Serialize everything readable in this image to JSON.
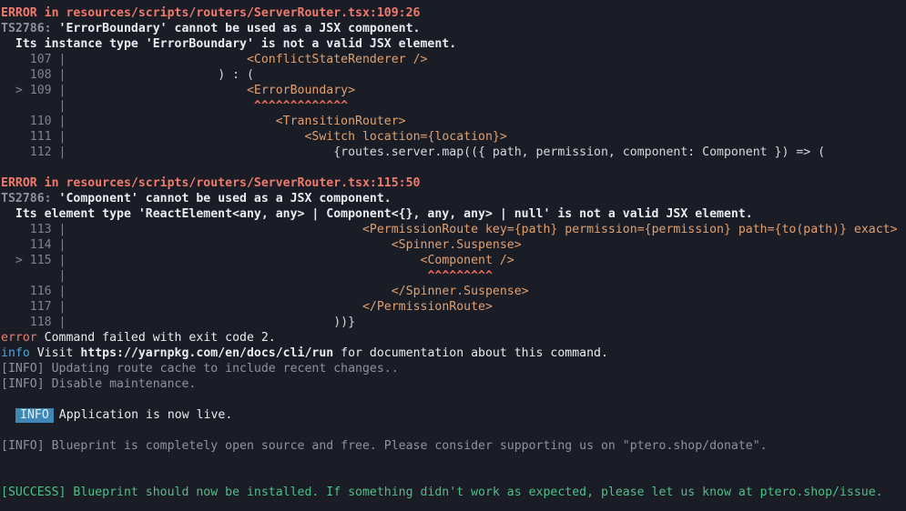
{
  "error1": {
    "header": "ERROR in resources/scripts/routers/ServerRouter.tsx:109:26",
    "code": "TS2786:",
    "message": " 'ErrorBoundary' cannot be used as a JSX component.",
    "detail": "  Its instance type 'ErrorBoundary' is not a valid JSX element.",
    "lines": [
      {
        "gutter": "    107 | ",
        "code": "                        <ConflictStateRenderer />"
      },
      {
        "gutter": "    108 | ",
        "code": "                    ) : ("
      },
      {
        "gutter": "  > 109 | ",
        "code": "                        <ErrorBoundary>"
      },
      {
        "gutter": "        | ",
        "code": "                         ^^^^^^^^^^^^^"
      },
      {
        "gutter": "    110 | ",
        "code": "                            <TransitionRouter>"
      },
      {
        "gutter": "    111 | ",
        "code": "                                <Switch location={location}>"
      },
      {
        "gutter": "    112 | ",
        "code": "                                    {routes.server.map(({ path, permission, component: Component }) => ("
      }
    ]
  },
  "error2": {
    "header": "ERROR in resources/scripts/routers/ServerRouter.tsx:115:50",
    "code": "TS2786:",
    "message": " 'Component' cannot be used as a JSX component.",
    "detail": "  Its element type 'ReactElement<any, any> | Component<{}, any, any> | null' is not a valid JSX element.",
    "lines": [
      {
        "gutter": "    113 | ",
        "code": "                                        <PermissionRoute key={path} permission={permission} path={to(path)} exact>"
      },
      {
        "gutter": "    114 | ",
        "code": "                                            <Spinner.Suspense>"
      },
      {
        "gutter": "  > 115 | ",
        "code": "                                                <Component />"
      },
      {
        "gutter": "        | ",
        "code": "                                                 ^^^^^^^^^"
      },
      {
        "gutter": "    116 | ",
        "code": "                                            </Spinner.Suspense>"
      },
      {
        "gutter": "    117 | ",
        "code": "                                        </PermissionRoute>"
      },
      {
        "gutter": "    118 | ",
        "code": "                                    ))}"
      }
    ]
  },
  "yarn": {
    "error_word": "error",
    "error_text": " Command failed with exit code 2.",
    "info_word": "info",
    "info_pre": " Visit ",
    "info_url": "https://yarnpkg.com/en/docs/cli/run",
    "info_post": " for documentation about this command."
  },
  "log": {
    "l1": "[INFO] Updating route cache to include recent changes..",
    "l2": "[INFO] Disable maintenance.",
    "badge": "INFO",
    "live": "Application is now live.",
    "l3": "[INFO] Blueprint is completely open source and free. Please consider supporting us on \"ptero.shop/donate\".",
    "success": "[SUCCESS] Blueprint should now be installed. If something didn't work as expected, please let us know at ptero.shop/issue."
  },
  "colors": {
    "background": "#1b1d26",
    "error_red": "#f07a6c",
    "info_blue": "#4ea3d6",
    "success_green": "#4fbf86",
    "jsx_tag": "#e0a070"
  }
}
